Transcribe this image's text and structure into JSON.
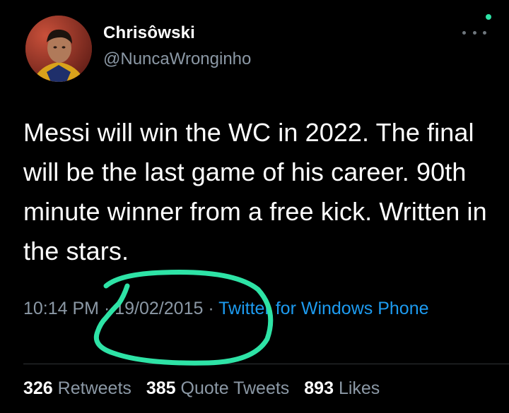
{
  "tweet": {
    "author": {
      "display_name": "Chrisôwski",
      "handle": "@NuncaWronginho"
    },
    "text": "Messi will win the WC in 2022. The final will be the last game of his career. 90th minute winner from a free kick. Written in the stars.",
    "meta": {
      "time": "10:14 PM",
      "separator": "·",
      "date": "19/02/2015",
      "source": "Twitter for Windows Phone"
    },
    "stats": {
      "retweets_count": "326",
      "retweets_label": "Retweets",
      "quote_count": "385",
      "quote_label": "Quote Tweets",
      "likes_count": "893",
      "likes_label": "Likes"
    }
  },
  "icons": {
    "more": "more-horizontal-icon",
    "status": "status-dot-icon"
  },
  "colors": {
    "background": "#000000",
    "primary_text": "#ffffff",
    "secondary_text": "#8b98a5",
    "link": "#1d9bf0",
    "annotation_circle": "#2ee3a6"
  }
}
